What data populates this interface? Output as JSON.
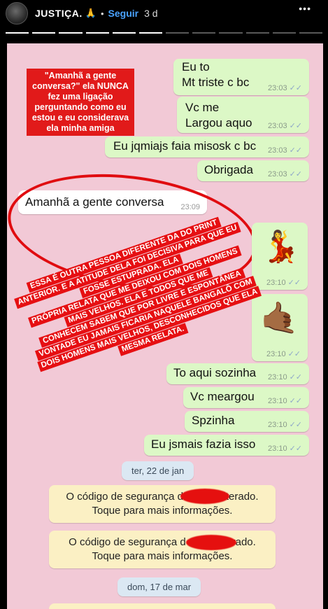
{
  "header": {
    "username": "JUSTIÇA.",
    "username_emoji": "🙏",
    "separator": "•",
    "follow_label": "Seguir",
    "time_ago": "3 d",
    "more_label": "•••",
    "close_label": "✕"
  },
  "progress": {
    "segments_total": 12,
    "segments_done": 6
  },
  "annotation_top": {
    "text": "\"Amanhã a gente conversa?\" ela NUNCA fez uma ligação perguntando como eu estou e eu considerava ela minha amiga"
  },
  "annotation_main": {
    "lines": [
      "ESSA É OUTRA PESSOA DIFERENTE DA DO PRINT",
      "ANTERIOR. E A ATITUDE DELA FOI DECISIVA PARA QUE EU",
      "FOSSE ESTUPRADA. ELA",
      "PRÓPRIA RELATA QUE ME DEIXOU COM DOIS HOMENS",
      "MAIS VELHOS. ELA E TODOS QUE ME",
      "CONHECEM SABEM QUE POR LIVRE E ESPONTÂNEA",
      "VONTADE EU JAMAIS FICARIA NAQUELE BANGALÔ COM",
      "DOIS HOMENS MAIS VELHOS, DESCONHECIDOS QUE ELA",
      "MESMA RELATA."
    ]
  },
  "messages": [
    {
      "id": "m1",
      "dir": "out",
      "lines": [
        "Eu to",
        "Mt triste c bc"
      ],
      "time": "23:03"
    },
    {
      "id": "m2",
      "dir": "out",
      "lines": [
        "Vc me",
        "Largou aquo"
      ],
      "time": "23:03"
    },
    {
      "id": "m3",
      "dir": "out",
      "lines": [
        "Eu jqmiajs faia misosk c bc"
      ],
      "time": "23:03"
    },
    {
      "id": "m4",
      "dir": "out",
      "lines": [
        "Obrigada"
      ],
      "time": "23:03"
    },
    {
      "id": "m5",
      "dir": "in",
      "lines": [
        "Amanhã a gente conversa"
      ],
      "time": "23:09"
    },
    {
      "id": "m6",
      "dir": "out",
      "emoji": "💃",
      "time": "23:10"
    },
    {
      "id": "m7",
      "dir": "out",
      "emoji": "🤙🏾",
      "time": "23:10"
    },
    {
      "id": "m8",
      "dir": "out",
      "lines": [
        "To aqui sozinha"
      ],
      "time": "23:10"
    },
    {
      "id": "m9",
      "dir": "out",
      "lines": [
        "Vc meargou"
      ],
      "time": "23:10"
    },
    {
      "id": "m10",
      "dir": "out",
      "lines": [
        "Spzinha"
      ],
      "time": "23:10"
    },
    {
      "id": "m11",
      "dir": "out",
      "lines": [
        "Eu jsmais fazia isso"
      ],
      "time": "23:10"
    }
  ],
  "tick_glyph": "✓✓",
  "date_pills": [
    "ter, 22 de jan",
    "dom, 17 de mar"
  ],
  "system_notes": [
    {
      "line1": "O código de segurança d          i alterado.",
      "line2": "Toque para mais informações."
    },
    {
      "line1": "O código de segurança d          alterado.",
      "line2": "Toque para mais informações."
    }
  ],
  "colors": {
    "background": "#f2c9d6",
    "outgoing": "#dcf8c6",
    "incoming": "#ffffff",
    "annotation_red": "#e60f12",
    "follow_blue": "#4aa3ff",
    "system_yellow": "#fbf0c4",
    "date_blue": "#dbe8f3"
  }
}
